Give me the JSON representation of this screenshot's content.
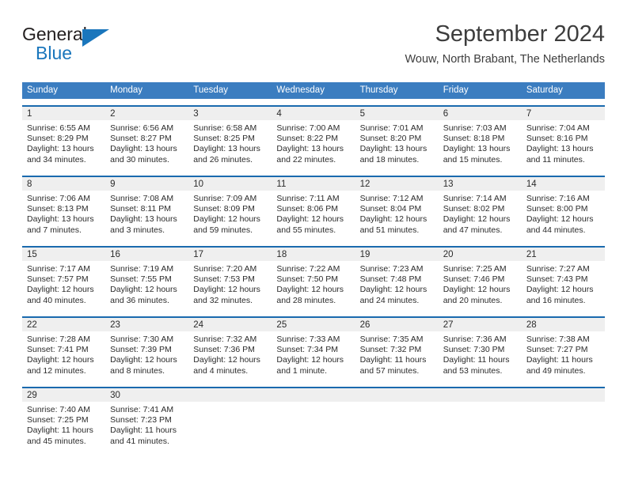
{
  "brand": {
    "name_part1": "General",
    "name_part2": "Blue",
    "flag_icon": "triangle-flag-icon",
    "color_primary": "#1a76bc"
  },
  "header": {
    "month_title": "September 2024",
    "location": "Wouw, North Brabant, The Netherlands"
  },
  "theme": {
    "header_blue": "#3b7dc0",
    "rule_blue": "#1a6aae",
    "daynum_band": "#efefef",
    "text": "#2b2b2b"
  },
  "weekdays": [
    "Sunday",
    "Monday",
    "Tuesday",
    "Wednesday",
    "Thursday",
    "Friday",
    "Saturday"
  ],
  "weeks": [
    [
      {
        "date": "1",
        "sunrise": "Sunrise: 6:55 AM",
        "sunset": "Sunset: 8:29 PM",
        "daylight_line1": "Daylight: 13 hours",
        "daylight_line2": "and 34 minutes."
      },
      {
        "date": "2",
        "sunrise": "Sunrise: 6:56 AM",
        "sunset": "Sunset: 8:27 PM",
        "daylight_line1": "Daylight: 13 hours",
        "daylight_line2": "and 30 minutes."
      },
      {
        "date": "3",
        "sunrise": "Sunrise: 6:58 AM",
        "sunset": "Sunset: 8:25 PM",
        "daylight_line1": "Daylight: 13 hours",
        "daylight_line2": "and 26 minutes."
      },
      {
        "date": "4",
        "sunrise": "Sunrise: 7:00 AM",
        "sunset": "Sunset: 8:22 PM",
        "daylight_line1": "Daylight: 13 hours",
        "daylight_line2": "and 22 minutes."
      },
      {
        "date": "5",
        "sunrise": "Sunrise: 7:01 AM",
        "sunset": "Sunset: 8:20 PM",
        "daylight_line1": "Daylight: 13 hours",
        "daylight_line2": "and 18 minutes."
      },
      {
        "date": "6",
        "sunrise": "Sunrise: 7:03 AM",
        "sunset": "Sunset: 8:18 PM",
        "daylight_line1": "Daylight: 13 hours",
        "daylight_line2": "and 15 minutes."
      },
      {
        "date": "7",
        "sunrise": "Sunrise: 7:04 AM",
        "sunset": "Sunset: 8:16 PM",
        "daylight_line1": "Daylight: 13 hours",
        "daylight_line2": "and 11 minutes."
      }
    ],
    [
      {
        "date": "8",
        "sunrise": "Sunrise: 7:06 AM",
        "sunset": "Sunset: 8:13 PM",
        "daylight_line1": "Daylight: 13 hours",
        "daylight_line2": "and 7 minutes."
      },
      {
        "date": "9",
        "sunrise": "Sunrise: 7:08 AM",
        "sunset": "Sunset: 8:11 PM",
        "daylight_line1": "Daylight: 13 hours",
        "daylight_line2": "and 3 minutes."
      },
      {
        "date": "10",
        "sunrise": "Sunrise: 7:09 AM",
        "sunset": "Sunset: 8:09 PM",
        "daylight_line1": "Daylight: 12 hours",
        "daylight_line2": "and 59 minutes."
      },
      {
        "date": "11",
        "sunrise": "Sunrise: 7:11 AM",
        "sunset": "Sunset: 8:06 PM",
        "daylight_line1": "Daylight: 12 hours",
        "daylight_line2": "and 55 minutes."
      },
      {
        "date": "12",
        "sunrise": "Sunrise: 7:12 AM",
        "sunset": "Sunset: 8:04 PM",
        "daylight_line1": "Daylight: 12 hours",
        "daylight_line2": "and 51 minutes."
      },
      {
        "date": "13",
        "sunrise": "Sunrise: 7:14 AM",
        "sunset": "Sunset: 8:02 PM",
        "daylight_line1": "Daylight: 12 hours",
        "daylight_line2": "and 47 minutes."
      },
      {
        "date": "14",
        "sunrise": "Sunrise: 7:16 AM",
        "sunset": "Sunset: 8:00 PM",
        "daylight_line1": "Daylight: 12 hours",
        "daylight_line2": "and 44 minutes."
      }
    ],
    [
      {
        "date": "15",
        "sunrise": "Sunrise: 7:17 AM",
        "sunset": "Sunset: 7:57 PM",
        "daylight_line1": "Daylight: 12 hours",
        "daylight_line2": "and 40 minutes."
      },
      {
        "date": "16",
        "sunrise": "Sunrise: 7:19 AM",
        "sunset": "Sunset: 7:55 PM",
        "daylight_line1": "Daylight: 12 hours",
        "daylight_line2": "and 36 minutes."
      },
      {
        "date": "17",
        "sunrise": "Sunrise: 7:20 AM",
        "sunset": "Sunset: 7:53 PM",
        "daylight_line1": "Daylight: 12 hours",
        "daylight_line2": "and 32 minutes."
      },
      {
        "date": "18",
        "sunrise": "Sunrise: 7:22 AM",
        "sunset": "Sunset: 7:50 PM",
        "daylight_line1": "Daylight: 12 hours",
        "daylight_line2": "and 28 minutes."
      },
      {
        "date": "19",
        "sunrise": "Sunrise: 7:23 AM",
        "sunset": "Sunset: 7:48 PM",
        "daylight_line1": "Daylight: 12 hours",
        "daylight_line2": "and 24 minutes."
      },
      {
        "date": "20",
        "sunrise": "Sunrise: 7:25 AM",
        "sunset": "Sunset: 7:46 PM",
        "daylight_line1": "Daylight: 12 hours",
        "daylight_line2": "and 20 minutes."
      },
      {
        "date": "21",
        "sunrise": "Sunrise: 7:27 AM",
        "sunset": "Sunset: 7:43 PM",
        "daylight_line1": "Daylight: 12 hours",
        "daylight_line2": "and 16 minutes."
      }
    ],
    [
      {
        "date": "22",
        "sunrise": "Sunrise: 7:28 AM",
        "sunset": "Sunset: 7:41 PM",
        "daylight_line1": "Daylight: 12 hours",
        "daylight_line2": "and 12 minutes."
      },
      {
        "date": "23",
        "sunrise": "Sunrise: 7:30 AM",
        "sunset": "Sunset: 7:39 PM",
        "daylight_line1": "Daylight: 12 hours",
        "daylight_line2": "and 8 minutes."
      },
      {
        "date": "24",
        "sunrise": "Sunrise: 7:32 AM",
        "sunset": "Sunset: 7:36 PM",
        "daylight_line1": "Daylight: 12 hours",
        "daylight_line2": "and 4 minutes."
      },
      {
        "date": "25",
        "sunrise": "Sunrise: 7:33 AM",
        "sunset": "Sunset: 7:34 PM",
        "daylight_line1": "Daylight: 12 hours",
        "daylight_line2": "and 1 minute."
      },
      {
        "date": "26",
        "sunrise": "Sunrise: 7:35 AM",
        "sunset": "Sunset: 7:32 PM",
        "daylight_line1": "Daylight: 11 hours",
        "daylight_line2": "and 57 minutes."
      },
      {
        "date": "27",
        "sunrise": "Sunrise: 7:36 AM",
        "sunset": "Sunset: 7:30 PM",
        "daylight_line1": "Daylight: 11 hours",
        "daylight_line2": "and 53 minutes."
      },
      {
        "date": "28",
        "sunrise": "Sunrise: 7:38 AM",
        "sunset": "Sunset: 7:27 PM",
        "daylight_line1": "Daylight: 11 hours",
        "daylight_line2": "and 49 minutes."
      }
    ],
    [
      {
        "date": "29",
        "sunrise": "Sunrise: 7:40 AM",
        "sunset": "Sunset: 7:25 PM",
        "daylight_line1": "Daylight: 11 hours",
        "daylight_line2": "and 45 minutes."
      },
      {
        "date": "30",
        "sunrise": "Sunrise: 7:41 AM",
        "sunset": "Sunset: 7:23 PM",
        "daylight_line1": "Daylight: 11 hours",
        "daylight_line2": "and 41 minutes."
      },
      {
        "date": "",
        "sunrise": "",
        "sunset": "",
        "daylight_line1": "",
        "daylight_line2": ""
      },
      {
        "date": "",
        "sunrise": "",
        "sunset": "",
        "daylight_line1": "",
        "daylight_line2": ""
      },
      {
        "date": "",
        "sunrise": "",
        "sunset": "",
        "daylight_line1": "",
        "daylight_line2": ""
      },
      {
        "date": "",
        "sunrise": "",
        "sunset": "",
        "daylight_line1": "",
        "daylight_line2": ""
      },
      {
        "date": "",
        "sunrise": "",
        "sunset": "",
        "daylight_line1": "",
        "daylight_line2": ""
      }
    ]
  ]
}
